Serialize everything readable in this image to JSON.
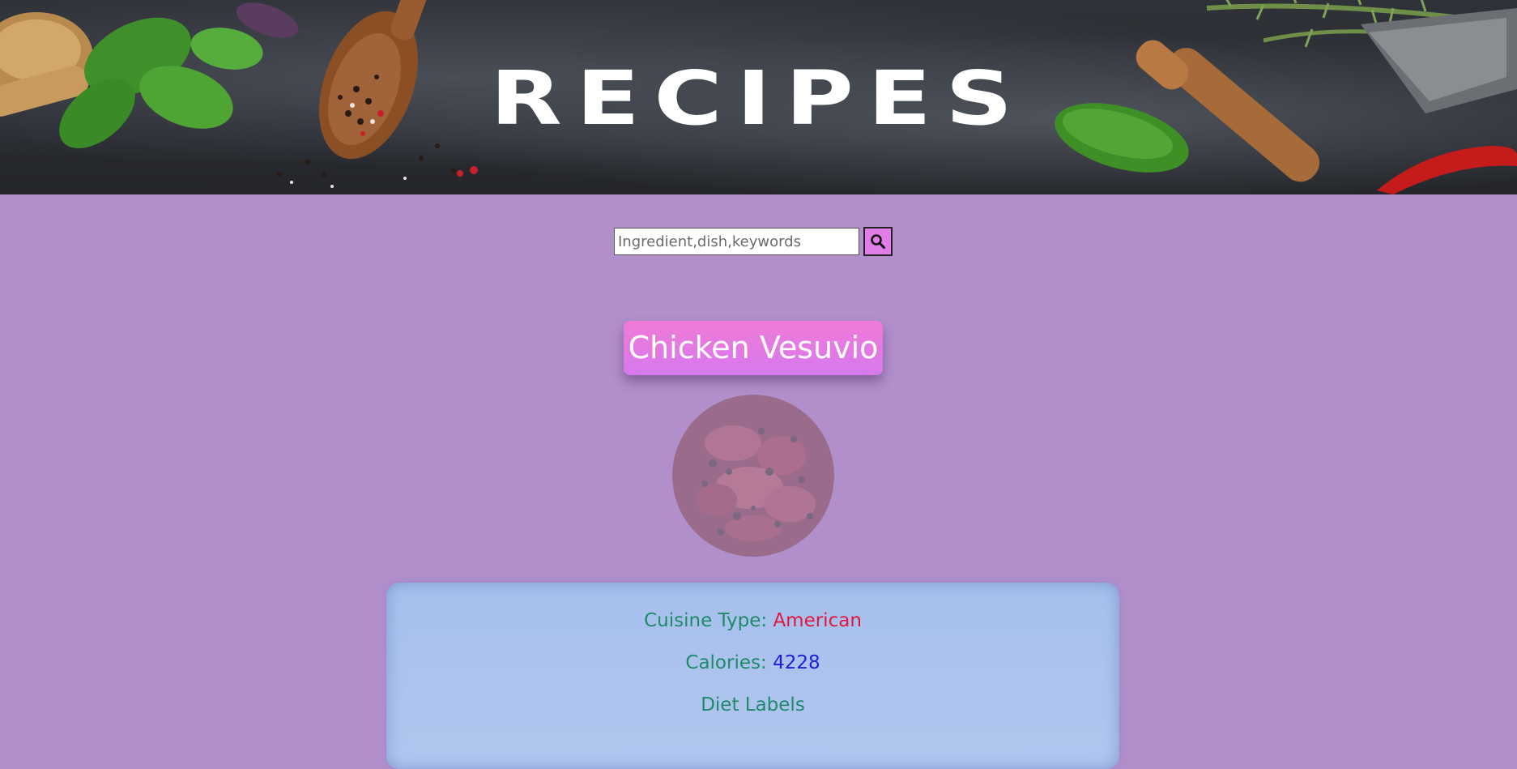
{
  "banner": {
    "title": "RECIPES"
  },
  "search": {
    "placeholder": "Ingredient,dish,keywords",
    "value": "",
    "button_icon": "search-icon"
  },
  "recipe": {
    "title": "Chicken Vesuvio",
    "image_alt": "Chicken Vesuvio",
    "cuisine_label": "Cuisine Type:",
    "cuisine_value": "American",
    "calories_label": "Calories:",
    "calories_value": "4228",
    "diet_labels_heading": "Diet Labels"
  },
  "colors": {
    "page_background": "#b18fcb",
    "title_badge": "#e47be3",
    "card_background": "#a9c2ed",
    "label_text": "#1f8a6a",
    "cuisine_value": "#e0163f",
    "calories_value": "#1d1de0",
    "search_button": "#e07de7"
  }
}
